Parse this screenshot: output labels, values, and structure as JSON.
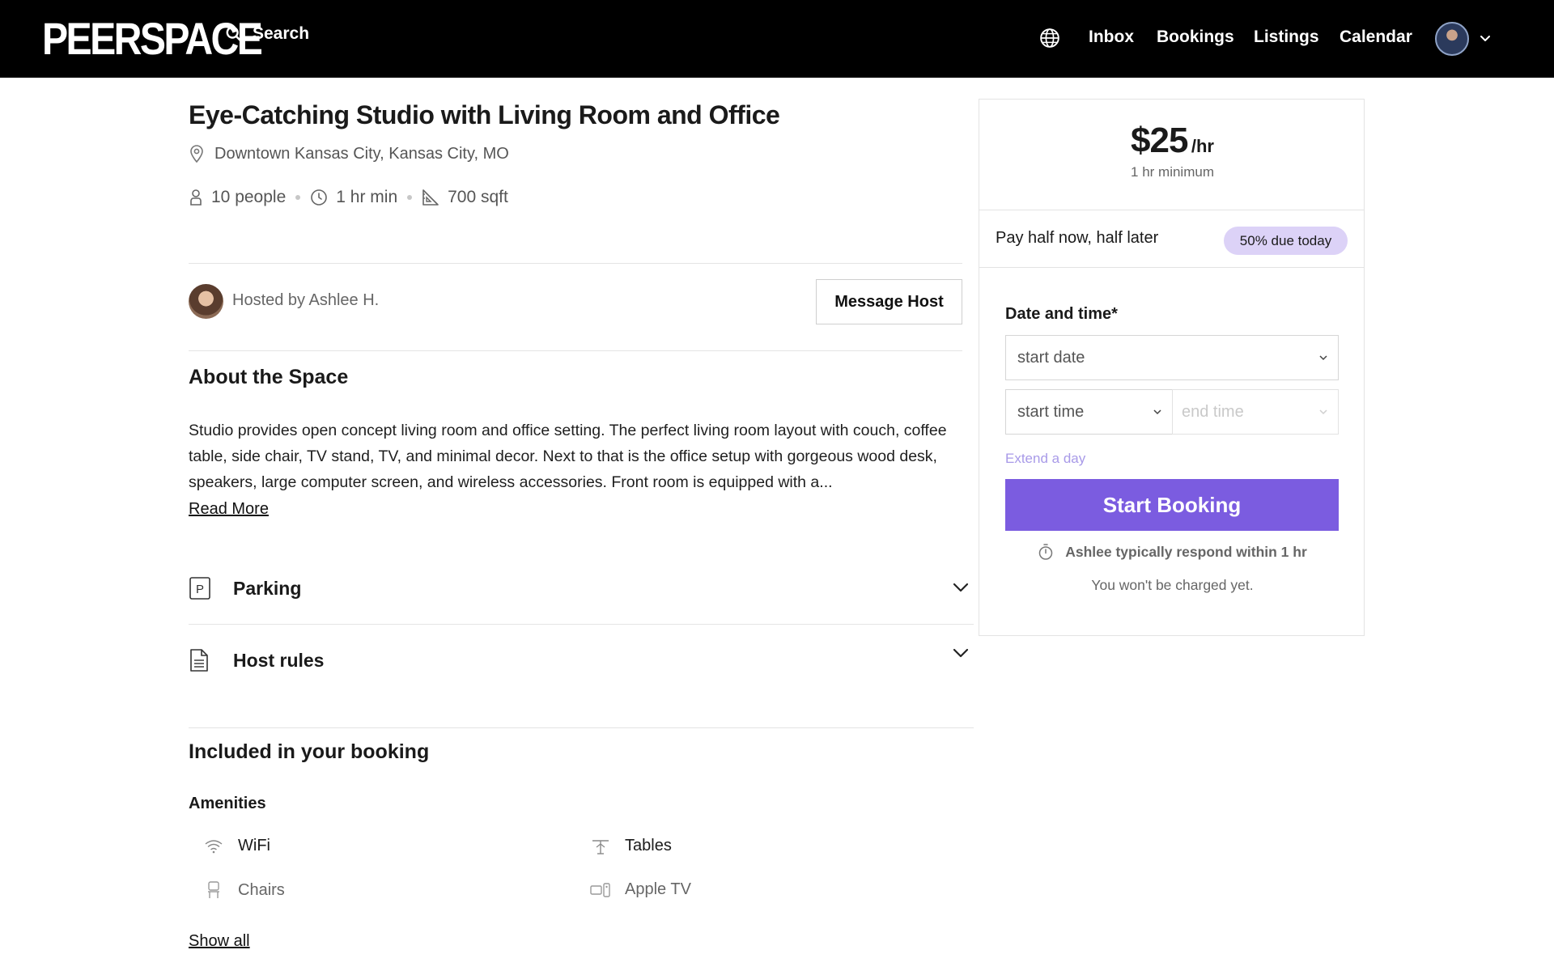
{
  "nav": {
    "logo": "PEERSPACE",
    "search_label": "Search",
    "links": [
      "Inbox",
      "Bookings",
      "Listings",
      "Calendar"
    ]
  },
  "listing": {
    "title": "Eye-Catching Studio with Living Room and Office",
    "location": "Downtown Kansas City, Kansas City, MO",
    "capacity": "10 people",
    "min_hours": "1 hr min",
    "area": "700 sqft",
    "hosted_by": "Hosted by Ashlee H.",
    "message_host": "Message Host"
  },
  "about": {
    "heading": "About the Space",
    "text": "Studio provides open concept living room and office setting. The perfect living room layout with couch, coffee table, side chair, TV stand, TV, and minimal decor. Next to that is the office setup with gorgeous wood desk, speakers, large computer screen, and wireless accessories. Front room is equipped with a...",
    "read_more": "Read More"
  },
  "sections": {
    "parking": "Parking",
    "host_rules": "Host rules"
  },
  "included": {
    "heading": "Included in your booking",
    "amenities_label": "Amenities",
    "amenities": [
      "WiFi",
      "Tables",
      "Chairs",
      "Apple TV"
    ],
    "show_all": "Show all"
  },
  "booking": {
    "price": "$25",
    "unit": "/hr",
    "minimum": "1 hr minimum",
    "pay_half": "Pay half now, half later",
    "badge": "50% due today",
    "date_time_label": "Date and time*",
    "start_date": "start date",
    "start_time": "start time",
    "end_time": "end time",
    "extend": "Extend a day",
    "cta": "Start Booking",
    "respond": "Ashlee typically respond within 1 hr",
    "not_charged": "You won't be charged yet."
  },
  "colors": {
    "accent": "#7b5ce0",
    "badge_bg": "#dcd2f7",
    "nav_bg": "#000000"
  }
}
